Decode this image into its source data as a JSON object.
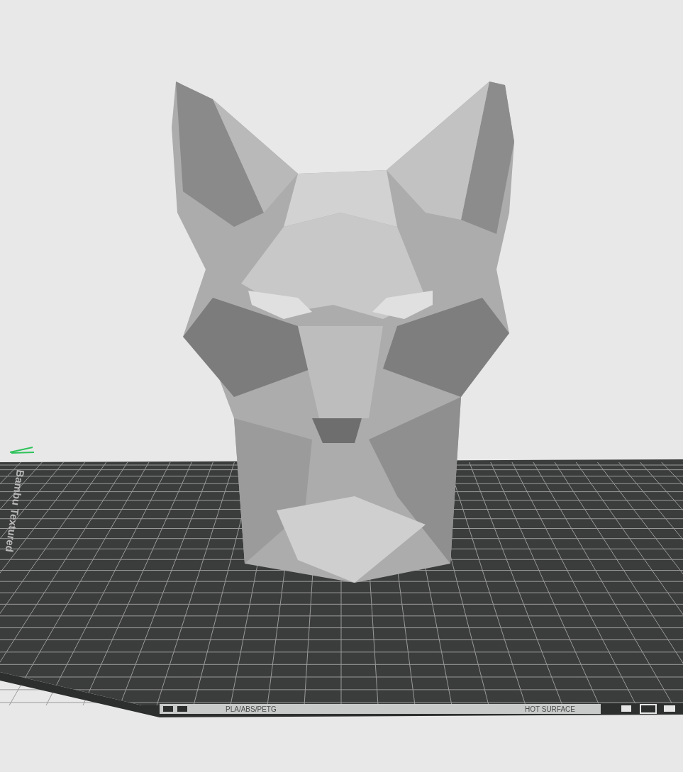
{
  "viewport": {
    "plate_name": "Bambu Textured",
    "plate_strip": {
      "materials": "PLA/ABS/PETG",
      "warning": [
        "HOT",
        "SURFACE"
      ]
    }
  }
}
